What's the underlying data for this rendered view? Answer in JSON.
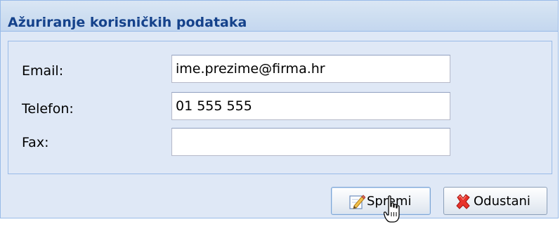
{
  "dialog": {
    "title": "Ažuriranje korisničkih podataka"
  },
  "form": {
    "fields": [
      {
        "label": "Email:",
        "value": "ime.prezime@firma.hr"
      },
      {
        "label": "Telefon:",
        "value": "01 555 555"
      },
      {
        "label": "Fax:",
        "value": ""
      }
    ]
  },
  "buttons": {
    "save_label": "Spremi",
    "save_icon": "edit-pencil-icon",
    "cancel_label": "Odustani",
    "cancel_icon": "red-x-icon"
  },
  "colors": {
    "title_text": "#15428b",
    "panel_background": "#dfe8f6",
    "panel_border": "#99bbe8"
  }
}
